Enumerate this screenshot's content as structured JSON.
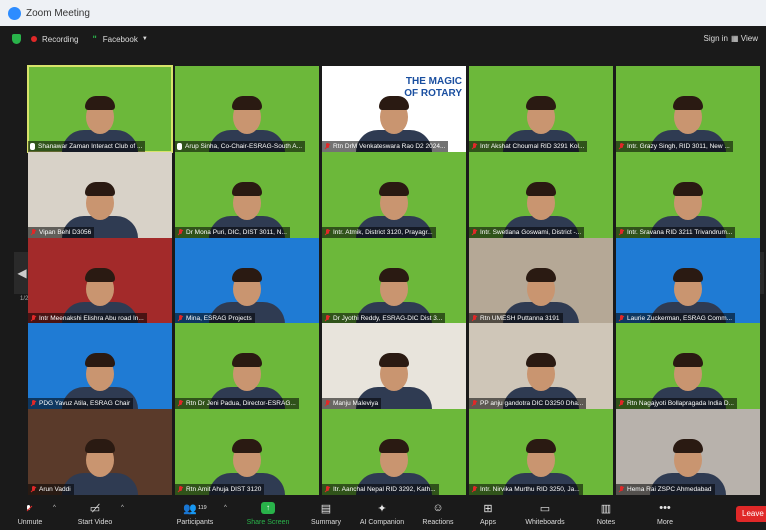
{
  "window": {
    "title": "Zoom Meeting"
  },
  "topbar": {
    "recording": "Recording",
    "stream": "Facebook",
    "signin": "Sign in",
    "view": "▦ View"
  },
  "nav": {
    "page": "1/2"
  },
  "tiles": [
    {
      "name": "Shanawar Zaman Interact Club of ...",
      "bg": "#6cb83a",
      "active": true,
      "muted": false
    },
    {
      "name": "Arup Sinha, Co-Chair-ESRAG-South A...",
      "bg": "#6cb83a",
      "active": false,
      "muted": false
    },
    {
      "name": "Rtn DrM Venkateswara Rao D2 2024...",
      "bg": "#ffffff",
      "active": false,
      "muted": true,
      "banner": "THE MAGIC OF ROTARY"
    },
    {
      "name": "Intr Akshat Choumal RID 3291 Kol...",
      "bg": "#6cb83a",
      "active": false,
      "muted": true
    },
    {
      "name": "Intr. Grazy Singh, RID 3011, New ...",
      "bg": "#6cb83a",
      "active": false,
      "muted": true
    },
    {
      "name": "Vipan Behl D3056",
      "bg": "#d8d2c8",
      "active": false,
      "muted": true
    },
    {
      "name": "Dr Mona Puri, DIC, DIST 3011, N...",
      "bg": "#6cb83a",
      "active": false,
      "muted": true
    },
    {
      "name": "Intr. Atmik, District 3120, Prayagr...",
      "bg": "#6cb83a",
      "active": false,
      "muted": true
    },
    {
      "name": "Intr. Swetlana Goswami, District -...",
      "bg": "#6cb83a",
      "active": false,
      "muted": true
    },
    {
      "name": "Intr. Sravana RID 3211 Trivandrum...",
      "bg": "#6cb83a",
      "active": false,
      "muted": true
    },
    {
      "name": "Intr Meenakshi Elishra Abu road In...",
      "bg": "#a32a2a",
      "active": false,
      "muted": true
    },
    {
      "name": "Mina, ESRAG Projects",
      "bg": "#1f7bd4",
      "active": false,
      "muted": true
    },
    {
      "name": "Dr Jyothi Reddy, ESRAG-DIC Dist 3...",
      "bg": "#6cb83a",
      "active": false,
      "muted": true
    },
    {
      "name": "Rtn UMESH Puttanna 3191",
      "bg": "#b5a896",
      "active": false,
      "muted": true
    },
    {
      "name": "Laurie Zuckerman, ESRAG Comm...",
      "bg": "#1f7bd4",
      "active": false,
      "muted": true
    },
    {
      "name": "PDG Yavuz Atila, ESRAG Chair",
      "bg": "#1f7bd4",
      "active": false,
      "muted": true
    },
    {
      "name": "Rtn Dr Jeni Padua, Director-ESRAG...",
      "bg": "#6cb83a",
      "active": false,
      "muted": true
    },
    {
      "name": "Manju Maleviya",
      "bg": "#e8e4dc",
      "active": false,
      "muted": true
    },
    {
      "name": "PP anju gandotra DIC D3250 Dha...",
      "bg": "#cfc6b8",
      "active": false,
      "muted": true
    },
    {
      "name": "Rtn Nagajyoti Bollapragada India D...",
      "bg": "#6cb83a",
      "active": false,
      "muted": true
    },
    {
      "name": "Arun Vaddi",
      "bg": "#5a3a2a",
      "active": false,
      "muted": true
    },
    {
      "name": "Rtn Amit Ahuja DIST 3120",
      "bg": "#6cb83a",
      "active": false,
      "muted": true
    },
    {
      "name": "Itr. Aanchal Nepal RID 3292, Kath...",
      "bg": "#6cb83a",
      "active": false,
      "muted": true
    },
    {
      "name": "Intr. Nirvika Murthu RID 3250, Ja...",
      "bg": "#6cb83a",
      "active": false,
      "muted": true
    },
    {
      "name": "Hema Rai ZSPC Ahmedabad",
      "bg": "#b8b2ac",
      "active": false,
      "muted": true
    }
  ],
  "toolbar": {
    "unmute": "Unmute",
    "start_video": "Start Video",
    "participants": "Participants",
    "participants_count": "119",
    "share_screen": "Share Screen",
    "summary": "Summary",
    "ai_companion": "AI Companion",
    "reactions": "Reactions",
    "apps": "Apps",
    "whiteboards": "Whiteboards",
    "notes": "Notes",
    "more": "More",
    "leave": "Leave"
  },
  "colors": {
    "accent_green": "#29b34a",
    "rotary_green": "#6cb83a",
    "zoom_blue": "#2d8cff",
    "leave_red": "#e02828"
  }
}
